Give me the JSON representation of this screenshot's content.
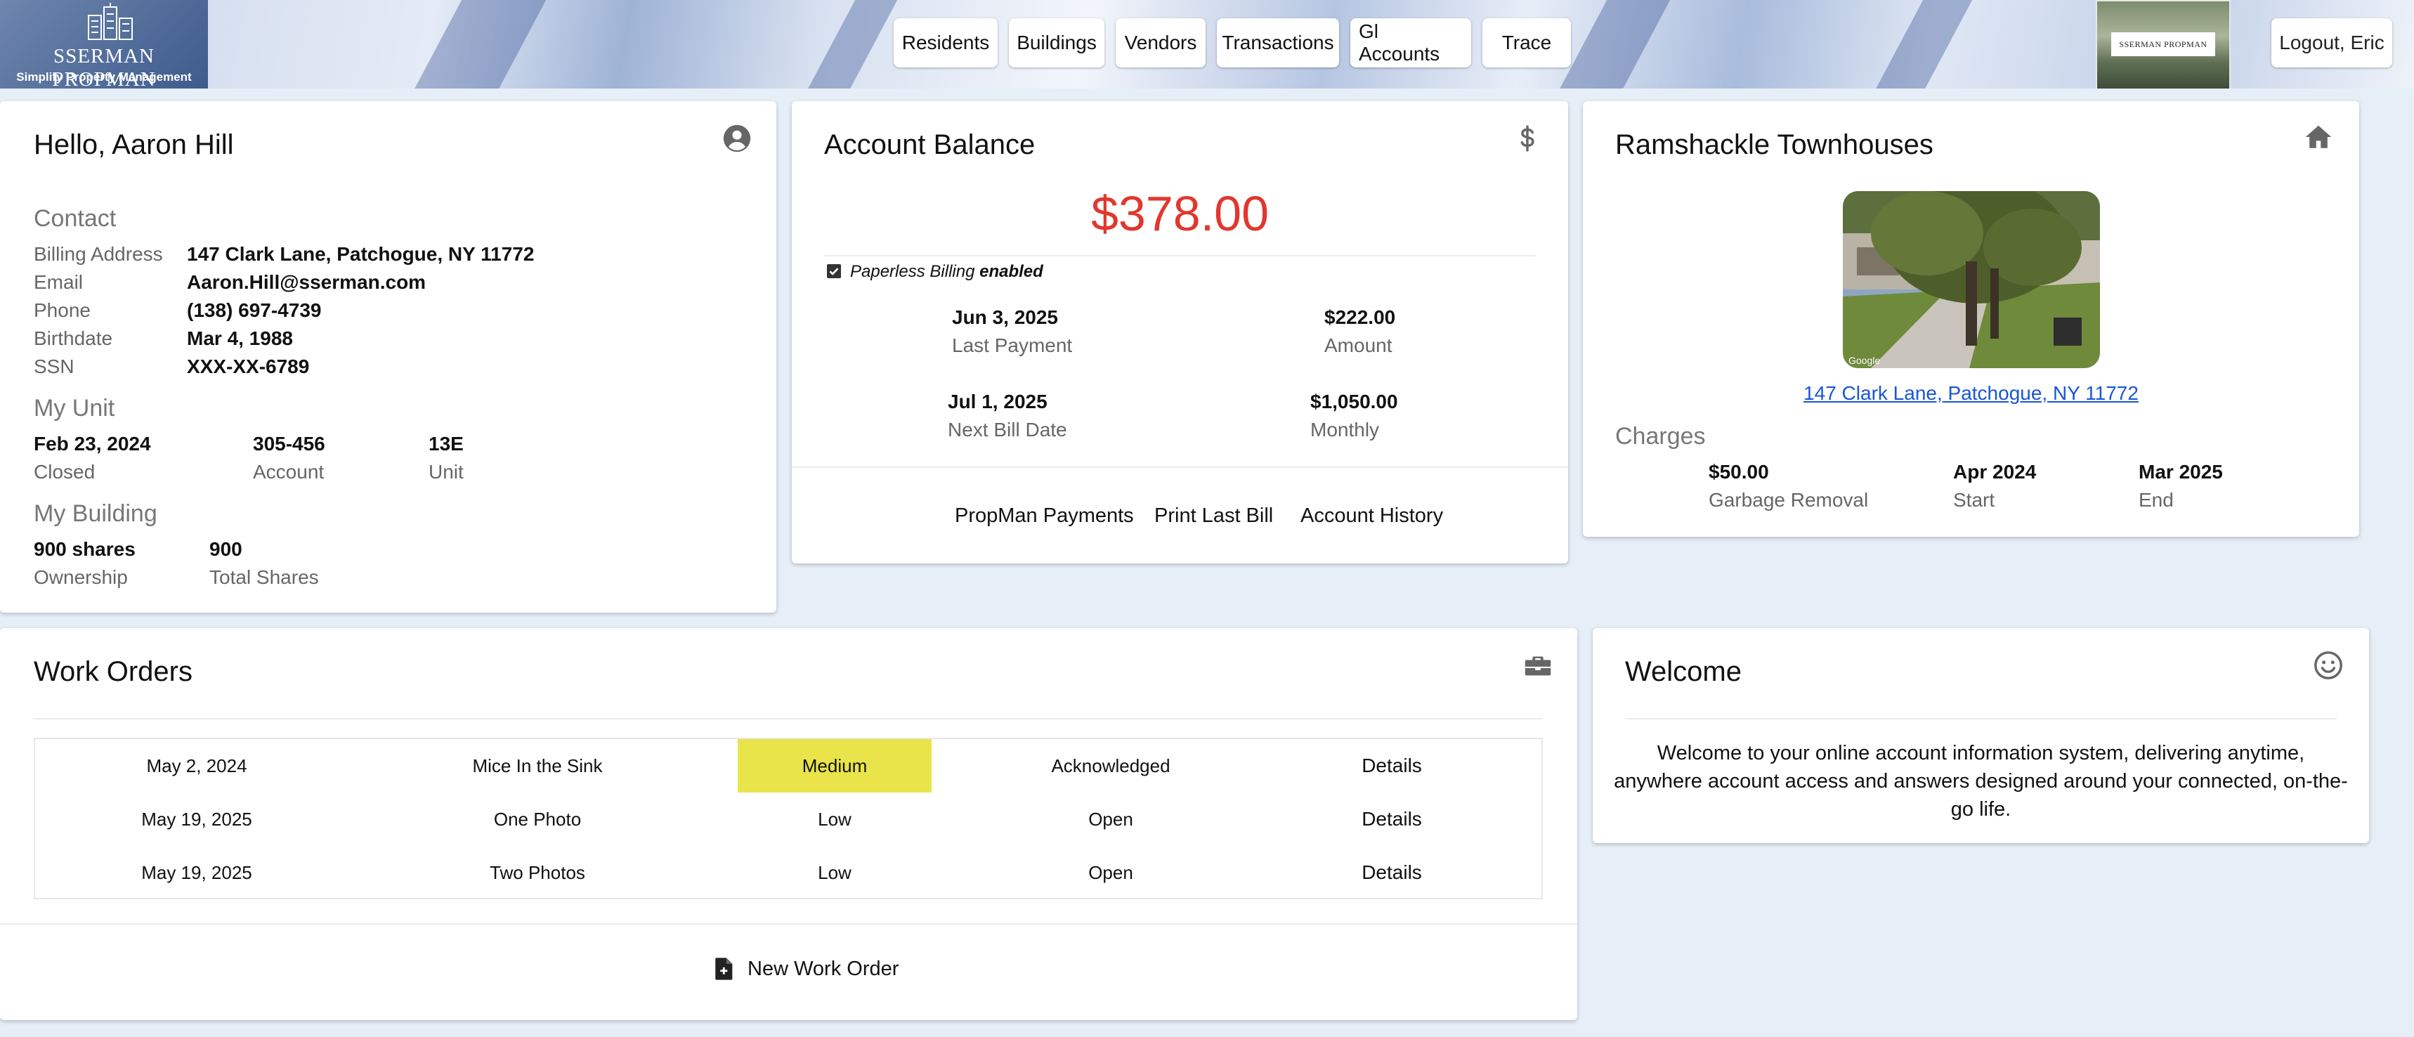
{
  "header": {
    "logo_name": "SSERMAN PROPMAN",
    "logo_tagline": "Simplify Property Management",
    "nav": [
      "Residents",
      "Buildings",
      "Vendors",
      "Transactions",
      "Gl Accounts",
      "Trace"
    ],
    "thumb_logo_text": "SSERMAN PROPMAN",
    "logout_label": "Logout, Eric"
  },
  "profile": {
    "greeting": "Hello, Aaron Hill",
    "contact_heading": "Contact",
    "billing_address_label": "Billing Address",
    "billing_address": "147 Clark Lane, Patchogue, NY 11772",
    "email_label": "Email",
    "email": "Aaron.Hill@sserman.com",
    "phone_label": "Phone",
    "phone": "(138) 697-4739",
    "birthdate_label": "Birthdate",
    "birthdate": "Mar 4, 1988",
    "ssn_label": "SSN",
    "ssn": "XXX-XX-6789",
    "unit_heading": "My Unit",
    "closed_value": "Feb 23, 2024",
    "closed_label": "Closed",
    "account_value": "305-456",
    "account_label": "Account",
    "unit_value": "13E",
    "unit_label": "Unit",
    "building_heading": "My Building",
    "ownership_value": "900 shares",
    "ownership_label": "Ownership",
    "total_shares_value": "900",
    "total_shares_label": "Total Shares"
  },
  "balance": {
    "title": "Account Balance",
    "amount": "$378.00",
    "amount_color": "#e0382e",
    "paperless_text": "Paperless Billing",
    "paperless_status": "enabled",
    "last_payment_value": "Jun 3, 2025",
    "last_payment_label": "Last Payment",
    "amount_value": "$222.00",
    "amount_label": "Amount",
    "next_bill_value": "Jul 1, 2025",
    "next_bill_label": "Next Bill Date",
    "monthly_value": "$1,050.00",
    "monthly_label": "Monthly",
    "actions": [
      "PropMan Payments",
      "Print Last Bill",
      "Account History"
    ]
  },
  "building": {
    "title": "Ramshackle Townhouses",
    "photo_label": "Google",
    "address_link": "147 Clark Lane, Patchogue, NY 11772",
    "charges_heading": "Charges",
    "charge_value": "$50.00",
    "charge_label": "Garbage Removal",
    "start_value": "Apr 2024",
    "start_label": "Start",
    "end_value": "Mar 2025",
    "end_label": "End"
  },
  "work_orders": {
    "title": "Work Orders",
    "rows": [
      {
        "date": "May 2, 2024",
        "title": "Mice In the Sink",
        "priority": "Medium",
        "status": "Acknowledged",
        "action": "Details"
      },
      {
        "date": "May 19, 2025",
        "title": "One Photo",
        "priority": "Low",
        "status": "Open",
        "action": "Details"
      },
      {
        "date": "May 19, 2025",
        "title": "Two Photos",
        "priority": "Low",
        "status": "Open",
        "action": "Details"
      }
    ],
    "medium_color": "#e8e44a",
    "new_label": "New Work Order"
  },
  "welcome": {
    "title": "Welcome",
    "line1": "Welcome to your online account information system, delivering anytime,",
    "line2": "anywhere account access and answers designed around your connected, on-the-",
    "line3": "go life."
  },
  "icons": {
    "profile": "user-circle-icon",
    "balance": "dollar-icon",
    "building": "home-icon",
    "work_orders": "toolbox-icon",
    "welcome": "smile-icon",
    "checkbox": "checkbox-checked-icon",
    "new_work_order": "file-plus-icon"
  }
}
